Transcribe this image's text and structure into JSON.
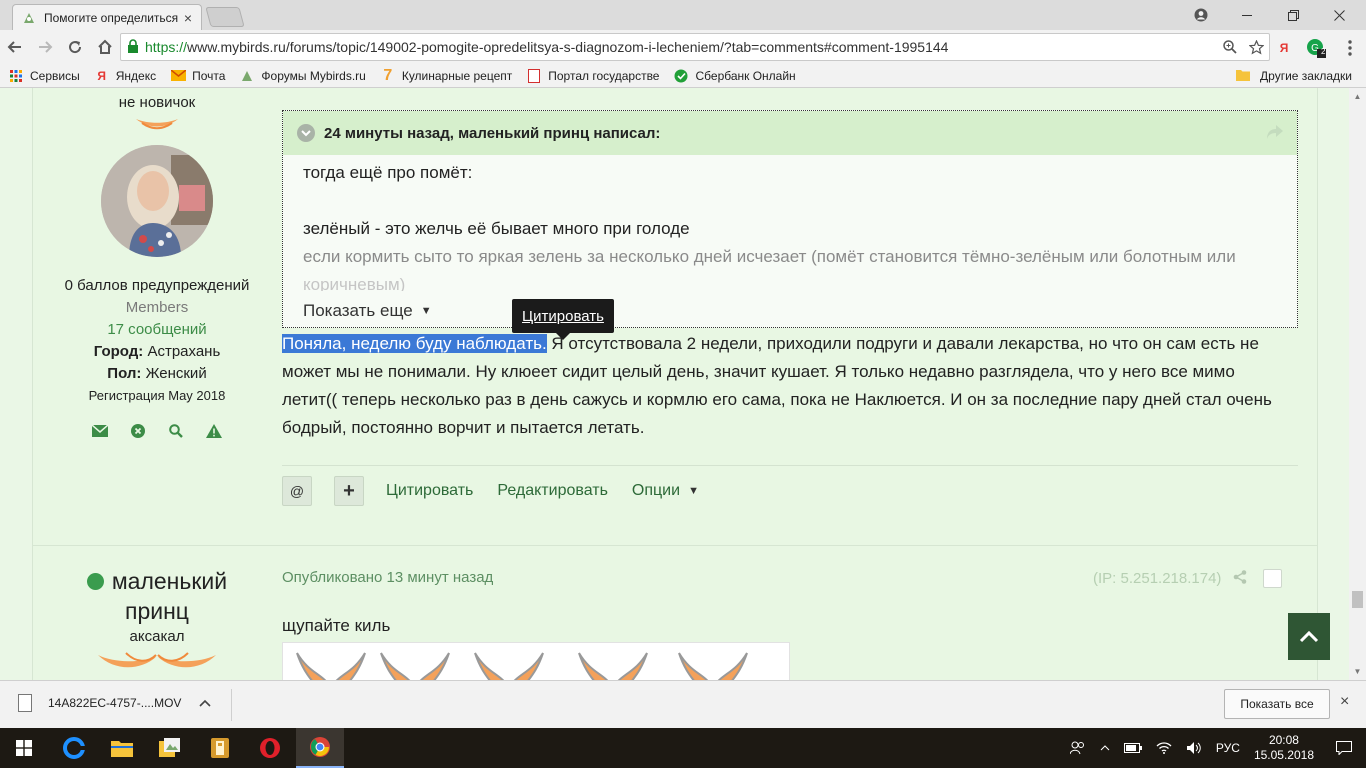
{
  "browser": {
    "tab_title": "Помогите определиться",
    "tab_close": "×",
    "url_scheme": "https://",
    "url_rest": "www.mybirds.ru/forums/topic/149002-pomogite-opredelitsya-s-diagnozom-i-lecheniem/?tab=comments#comment-1995144",
    "ext_badge": "2",
    "bookmarks": [
      {
        "label": "Сервисы",
        "icon": "apps-grid-icon"
      },
      {
        "label": "Яндекс",
        "icon": "yandex-icon"
      },
      {
        "label": "Почта",
        "icon": "mail-icon"
      },
      {
        "label": "Форумы Mybirds.ru",
        "icon": "mybirds-icon"
      },
      {
        "label": "Кулинарные рецепт",
        "icon": "recipe-icon"
      },
      {
        "label": "Портал государстве",
        "icon": "gosuslugi-icon"
      },
      {
        "label": "Сбербанк Онлайн",
        "icon": "sberbank-icon"
      }
    ],
    "other_bookmarks": "Другие закладки",
    "colors": {
      "accent_green": "#1a8a2e",
      "page_bg": "#eaf7e6",
      "quote_head": "#d6efcc",
      "selection": "#3b79d6"
    }
  },
  "post1": {
    "author_rank": "не новичок",
    "warnings": "0 баллов предупреждений",
    "group": "Members",
    "posts": "17 сообщений",
    "city_label": "Город:",
    "city": "Астрахань",
    "sex_label": "Пол:",
    "sex": "Женский",
    "registered": "Регистрация May 2018",
    "quote": {
      "header": "24 минуты назад, маленький принц написал:",
      "line1": "тогда ещё про помёт:",
      "line2": "зелёный - это желчь её бывает много при голоде",
      "line3": "если кормить сыто то яркая зелень за несколько дней исчезает (помёт становится тёмно-зелёным или болотным или",
      "line4": "коричневым)",
      "show_more": "Показать еще"
    },
    "tooltip": "Цитировать",
    "text_selected": "Поняла, неделю буду наблюдать.",
    "text_rest": " Я отсутствовала 2 недели, приходили подруги и давали лекарства, но что он сам есть не может мы не понимали. Ну клюеет сидит целый день, значит кушает. Я только недавно разглядела, что у него все мимо летит(( теперь несколько раз в день сажусь и кормлю его сама, пока не Наклюется. И он за последние пару дней стал очень бодрый, постоянно ворчит и пытается летать.",
    "btn_mention": "@",
    "btn_plus": "+",
    "quote_link": "Цитировать",
    "edit_link": "Редактировать",
    "options_link": "Опции"
  },
  "post2": {
    "author_line1": "маленький",
    "author_line2": "принц",
    "author_rank": "аксакал",
    "posted": "Опубликовано 13 минут назад",
    "ip": "(IP: 5.251.218.174)",
    "text": "щупайте киль"
  },
  "downloads": {
    "file": "14A822EC-4757-....MOV",
    "show_all": "Показать все",
    "close": "×"
  },
  "taskbar": {
    "lang": "РУС",
    "time": "20:08",
    "date": "15.05.2018"
  }
}
